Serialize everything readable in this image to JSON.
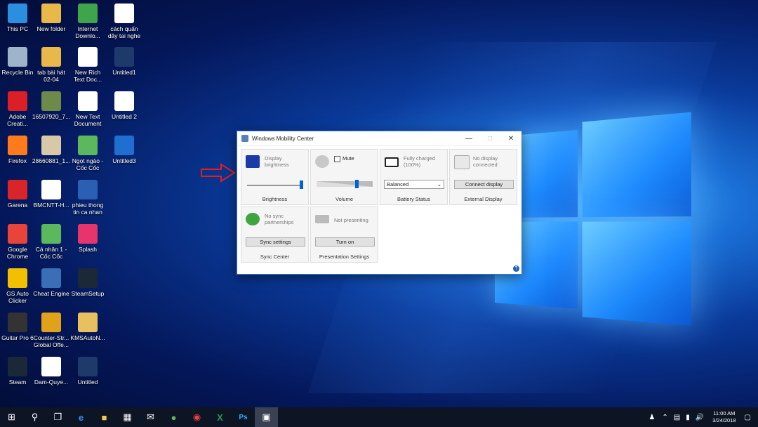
{
  "desktop": {
    "icons": [
      {
        "label": "This PC",
        "color": "#2b8fe0"
      },
      {
        "label": "New folder",
        "color": "#e8b84a"
      },
      {
        "label": "Internet\nDownlo...",
        "color": "#3fa54b"
      },
      {
        "label": "cách quấn\ndây tai nghe",
        "color": "#ffffff"
      },
      {
        "label": "Recycle Bin",
        "color": "#9fb4c8"
      },
      {
        "label": "tab bài hát\n02-04",
        "color": "#e8b84a"
      },
      {
        "label": "New Rich\nText Doc...",
        "color": "#ffffff"
      },
      {
        "label": "Untitled1",
        "color": "#1e3a6a"
      },
      {
        "label": "Adobe\nCreati...",
        "color": "#da1f26"
      },
      {
        "label": "16507920_7...",
        "color": "#6d8a4a"
      },
      {
        "label": "New Text\nDocument",
        "color": "#ffffff"
      },
      {
        "label": "Untitled 2",
        "color": "#ffffff"
      },
      {
        "label": "Firefox",
        "color": "#ff7a1a"
      },
      {
        "label": "28660881_1...",
        "color": "#d8c8a8"
      },
      {
        "label": "Ngọt ngào -\nCốc Cốc",
        "color": "#5cb85c"
      },
      {
        "label": "Untitled3",
        "color": "#1f6fd0"
      },
      {
        "label": "Garena",
        "color": "#d9252a"
      },
      {
        "label": "BMCNTT-H...",
        "color": "#ffffff"
      },
      {
        "label": "phieu thong\ntin  ca nhan",
        "color": "#2b5fb4"
      },
      {
        "label": "Google\nChrome",
        "color": "#e8443a"
      },
      {
        "label": "Cá nhân 1 -\nCốc Cốc",
        "color": "#5cb85c"
      },
      {
        "label": "Splash",
        "color": "#e5356b"
      },
      {
        "label": "GS Auto\nClicker",
        "color": "#f3c000"
      },
      {
        "label": "Cheat Engine",
        "color": "#3a6fb6"
      },
      {
        "label": "SteamSetup",
        "color": "#1b2838"
      },
      {
        "label": "Guitar Pro 6",
        "color": "#333333"
      },
      {
        "label": "Counter-Str...\nGlobal Offe...",
        "color": "#e0a21a"
      },
      {
        "label": "KMSAutoN...",
        "color": "#e8c060"
      },
      {
        "label": "Steam",
        "color": "#1b2838"
      },
      {
        "label": "Dam-Quye...",
        "color": "#ffffff"
      },
      {
        "label": "Untitled",
        "color": "#1e3a6a"
      }
    ]
  },
  "window": {
    "title": "Windows Mobility Center",
    "tiles": {
      "brightness": {
        "text": "Display\nbrightness",
        "footer": "Brightness",
        "level": 0.97
      },
      "volume": {
        "mute_label": "Mute",
        "footer": "Volume",
        "level": 0.72
      },
      "battery": {
        "text": "Fully charged\n(100%)",
        "select": "Balanced",
        "footer": "Battery Status"
      },
      "display": {
        "text": "No display\nconnected",
        "button": "Connect display",
        "footer": "External Display"
      },
      "sync": {
        "text": "No sync\npartnerships",
        "button": "Sync settings",
        "footer": "Sync Center"
      },
      "presentation": {
        "text": "Not presenting",
        "button": "Turn on",
        "footer": "Presentation Settings"
      }
    }
  },
  "taskbar": {
    "time": "11:00 AM",
    "date": "3/24/2018"
  }
}
